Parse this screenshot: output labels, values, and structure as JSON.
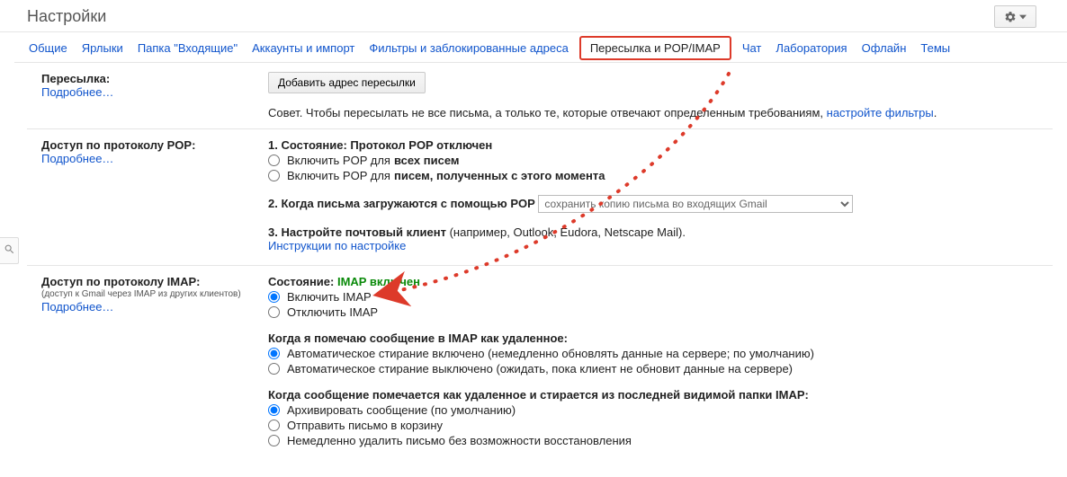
{
  "header": {
    "title": "Настройки"
  },
  "tabs": {
    "items": [
      "Общие",
      "Ярлыки",
      "Папка \"Входящие\"",
      "Аккаунты и импорт",
      "Фильтры и заблокированные адреса",
      "Пересылка и POP/IMAP",
      "Чат",
      "Лаборатория",
      "Офлайн",
      "Темы"
    ],
    "active_index": 5
  },
  "forwarding": {
    "label": "Пересылка:",
    "learn_more": "Подробнее…",
    "add_button": "Добавить адрес пересылки",
    "tip_prefix": "Совет. Чтобы пересылать не все письма, а только те, которые отвечают определенным требованиям, ",
    "tip_link": "настройте фильтры",
    "tip_suffix": "."
  },
  "pop": {
    "label": "Доступ по протоколу POP:",
    "learn_more": "Подробнее…",
    "status_num": "1. Состояние: ",
    "status_text": "Протокол POP отключен",
    "opt_all_prefix": "Включить POP для ",
    "opt_all_bold": "всех писем",
    "opt_now_prefix": "Включить POP для ",
    "opt_now_bold": "писем, полученных с этого момента",
    "step2": "2. Когда письма загружаются с помощью POP",
    "select_value": "сохранить копию письма во входящих Gmail",
    "step3_bold": "3. Настройте почтовый клиент",
    "step3_rest": " (например, Outlook, Eudora, Netscape Mail).",
    "instructions_link": "Инструкции по настройке"
  },
  "imap": {
    "label": "Доступ по протоколу IMAP:",
    "sublabel": "(доступ к Gmail через IMAP из других клиентов)",
    "learn_more": "Подробнее…",
    "status_label": "Состояние: ",
    "status_value": "IMAP включен",
    "opt_enable": "Включить IMAP",
    "opt_disable": "Отключить IMAP",
    "delete_heading": "Когда я помечаю сообщение в IMAP как удаленное:",
    "delete_opt1": "Автоматическое стирание включено (немедленно обновлять данные на сервере; по умолчанию)",
    "delete_opt2": "Автоматическое стирание выключено (ожидать, пока клиент не обновит данные на сервере)",
    "expunge_heading": "Когда сообщение помечается как удаленное и стирается из последней видимой папки IMAP:",
    "expunge_opt1": "Архивировать сообщение (по умолчанию)",
    "expunge_opt2": "Отправить письмо в корзину",
    "expunge_opt3": "Немедленно удалить письмо без возможности восстановления"
  }
}
